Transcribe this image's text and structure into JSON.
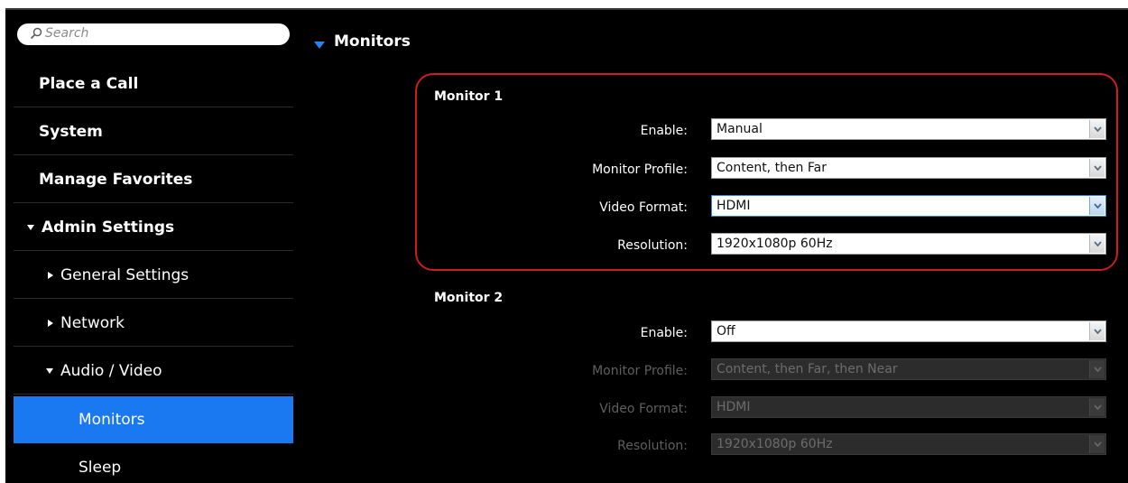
{
  "search": {
    "placeholder": "Search"
  },
  "sidebar": {
    "items": [
      {
        "label": "Place a Call"
      },
      {
        "label": "System"
      },
      {
        "label": "Manage Favorites"
      },
      {
        "label": "Admin Settings"
      },
      {
        "label": "General Settings"
      },
      {
        "label": "Network"
      },
      {
        "label": "Audio / Video"
      },
      {
        "label": "Monitors",
        "selected": true
      },
      {
        "label": "Sleep"
      }
    ]
  },
  "main": {
    "title": "Monitors",
    "monitor1": {
      "title": "Monitor 1",
      "enable": {
        "label": "Enable:",
        "value": "Manual"
      },
      "profile": {
        "label": "Monitor Profile:",
        "value": "Content, then Far"
      },
      "format": {
        "label": "Video Format:",
        "value": "HDMI"
      },
      "resolution": {
        "label": "Resolution:",
        "value": "1920x1080p 60Hz"
      }
    },
    "monitor2": {
      "title": "Monitor 2",
      "enable": {
        "label": "Enable:",
        "value": "Off"
      },
      "profile": {
        "label": "Monitor Profile:",
        "value": "Content, then Far, then Near"
      },
      "format": {
        "label": "Video Format:",
        "value": "HDMI"
      },
      "resolution": {
        "label": "Resolution:",
        "value": "1920x1080p 60Hz"
      }
    }
  },
  "colors": {
    "accent": "#1a78f0",
    "highlight": "#d01c1c",
    "background": "#000000"
  }
}
